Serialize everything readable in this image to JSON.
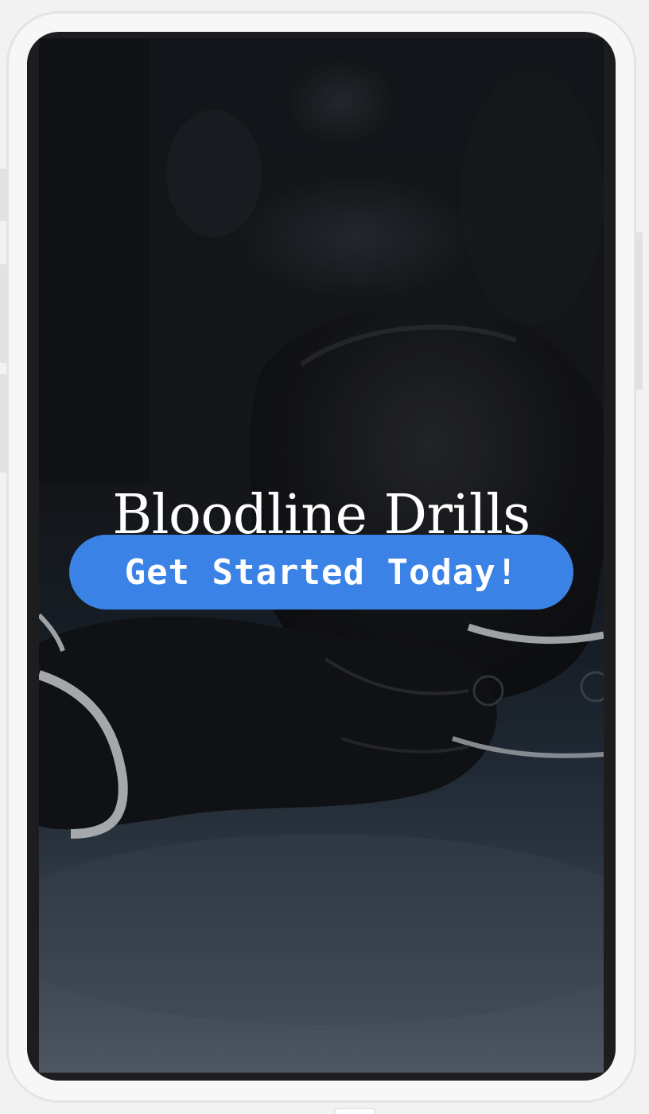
{
  "app": {
    "title": "Bloodline Drills"
  },
  "hero": {
    "cta_label": "Get Started Today!"
  },
  "background": {
    "image_name": "boxing-gloves-photo",
    "overlay": "dark"
  },
  "colors": {
    "accent": "#3b82e6",
    "title_text": "#ffffff",
    "screen_bg": "#121417",
    "device_frame": "#f7f7f7"
  }
}
